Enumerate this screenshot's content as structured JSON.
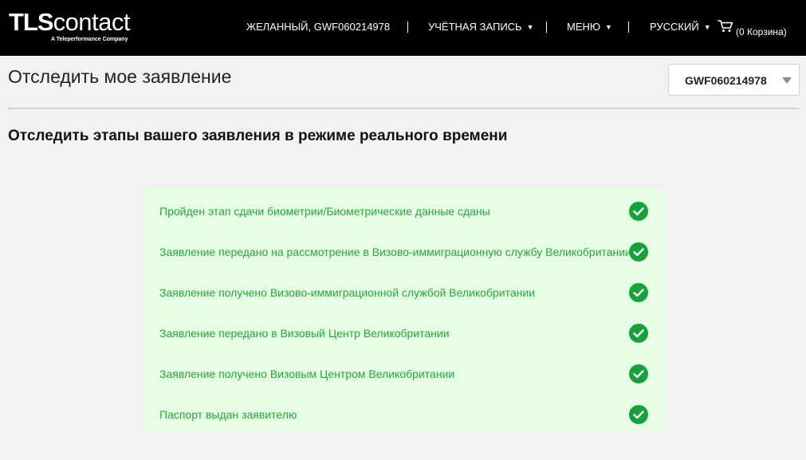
{
  "header": {
    "logo": {
      "main_bold": "TLS",
      "main_light": "contact",
      "tagline": "A Teleperformance Company"
    },
    "user_label": "ЖЕЛАННЫЙ, GWF060214978",
    "account_label": "УЧЁТНАЯ ЗАПИСЬ",
    "menu_label": "МЕНЮ",
    "language_label": "РУССКИЙ",
    "cart_label": "(0 Корзина)",
    "cart_icon": "shopping-cart-icon"
  },
  "page": {
    "title": "Отследить мое заявление",
    "application_select": {
      "value": "GWF060214978"
    },
    "section_heading": "Отследить этапы вашего заявления в режиме реального времени"
  },
  "statuses": [
    {
      "label": "Пройден этап сдачи биометрии/Биометрические данные сданы",
      "completed": true
    },
    {
      "label": "Заявление передано на рассмотрение в Визово-иммиграционную службу Великобритании",
      "completed": true
    },
    {
      "label": "Заявление получено Визово-иммиграционной службой Великобритании",
      "completed": true
    },
    {
      "label": "Заявление передано в Визовый Центр Великобритании",
      "completed": true
    },
    {
      "label": "Заявление получено Визовым Центром Великобритании",
      "completed": true
    },
    {
      "label": "Паспорт выдан заявителю",
      "completed": true
    }
  ],
  "colors": {
    "header_bg": "#000000",
    "page_bg": "#f2f2f2",
    "status_panel_bg": "#e6fde6",
    "status_text": "#25a837",
    "check_bg": "#16a13a"
  }
}
